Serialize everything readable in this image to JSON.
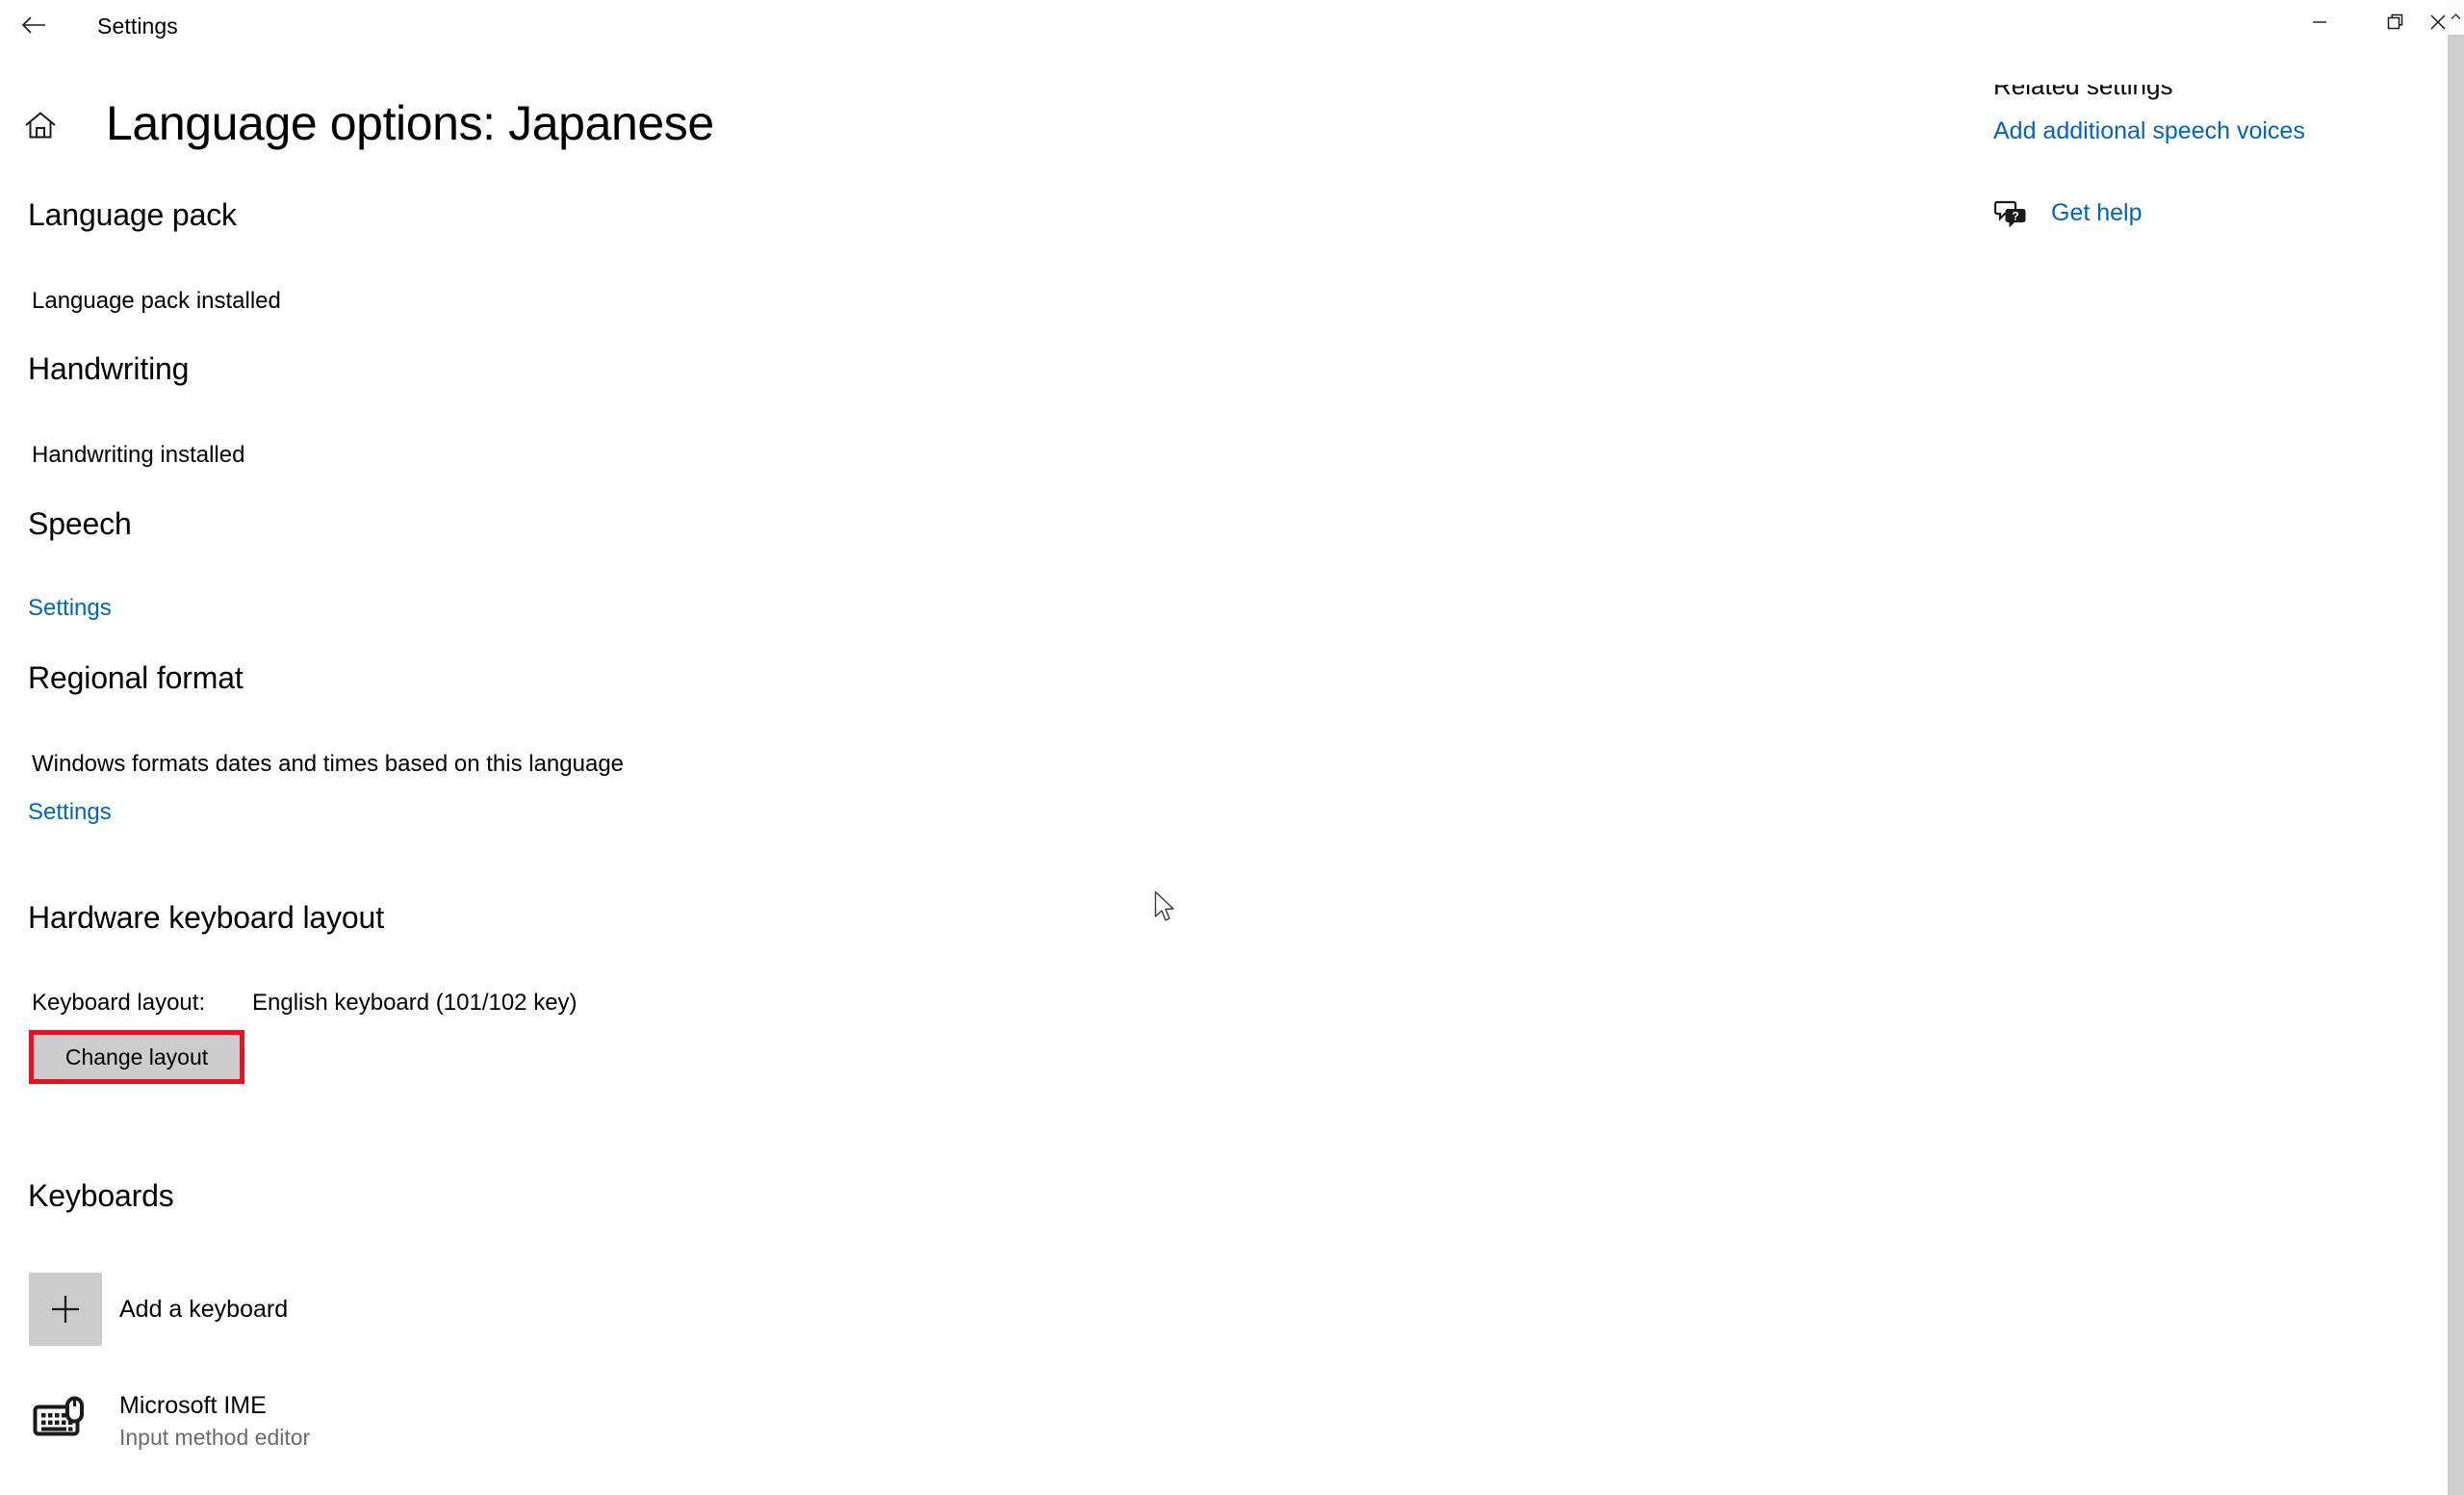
{
  "window": {
    "app_title": "Settings",
    "back_icon": "back-arrow-icon",
    "controls": {
      "minimize": "minimize-icon",
      "maximize": "restore-icon",
      "close": "close-icon"
    }
  },
  "header": {
    "home_icon": "home-icon",
    "page_title": "Language options: Japanese"
  },
  "sections": {
    "language_pack": {
      "heading": "Language pack",
      "status": "Language pack installed"
    },
    "handwriting": {
      "heading": "Handwriting",
      "status": "Handwriting installed"
    },
    "speech": {
      "heading": "Speech",
      "settings_link": "Settings"
    },
    "regional_format": {
      "heading": "Regional format",
      "description": "Windows formats dates and times based on this language",
      "settings_link": "Settings"
    },
    "hardware_keyboard_layout": {
      "heading": "Hardware keyboard layout",
      "layout_label": "Keyboard layout:",
      "layout_value": "English keyboard (101/102 key)",
      "change_button": "Change layout",
      "highlight_color": "#e81123"
    },
    "keyboards": {
      "heading": "Keyboards",
      "add_keyboard": {
        "icon": "plus-icon",
        "label": "Add a keyboard"
      },
      "items": [
        {
          "icon": "keyboard-ime-icon",
          "title": "Microsoft IME",
          "subtitle": "Input method editor"
        }
      ]
    }
  },
  "right_rail": {
    "related_settings_heading": "Related settings",
    "speech_voices_link": "Add additional speech voices",
    "get_help": {
      "icon": "help-chat-icon",
      "label": "Get help"
    }
  },
  "colors": {
    "link_blue": "#0064c0",
    "button_gray": "#cccccc",
    "highlight_red": "#e81123"
  }
}
